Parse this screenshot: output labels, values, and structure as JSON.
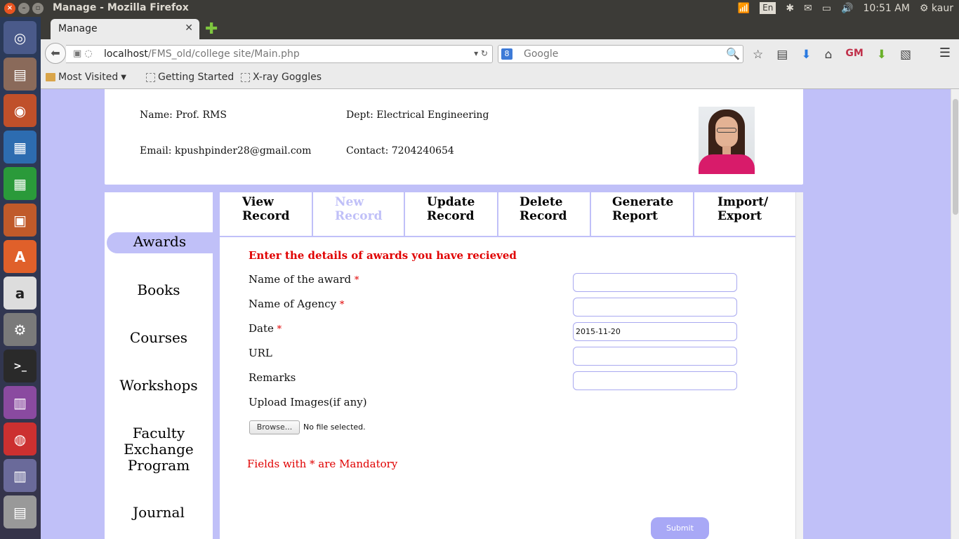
{
  "system": {
    "window_title": "Manage - Mozilla Firefox",
    "keyboard": "En",
    "time": "10:51 AM",
    "user": "kaur"
  },
  "browser": {
    "tab_title": "Manage",
    "url_host": "localhost",
    "url_path": "/FMS_old/college site/Main.php",
    "search_placeholder": "Google",
    "bookmarks": [
      "Most Visited",
      "Getting Started",
      "X-ray Goggles"
    ]
  },
  "profile": {
    "name": "Name: Prof. RMS",
    "dept": "Dept: Electrical Engineering",
    "email": "Email: kpushpinder28@gmail.com",
    "contact": "Contact: 7204240654"
  },
  "sidebar": {
    "items": [
      {
        "label": "Awards"
      },
      {
        "label": "Books"
      },
      {
        "label": "Courses"
      },
      {
        "label": "Workshops"
      },
      {
        "label": "Faculty Exchange Program"
      },
      {
        "label": "Journal"
      }
    ]
  },
  "tabs": [
    {
      "line1": "View",
      "line2": "Record"
    },
    {
      "line1": "New",
      "line2": "Record"
    },
    {
      "line1": "Update",
      "line2": "Record"
    },
    {
      "line1": "Delete",
      "line2": "Record"
    },
    {
      "line1": "Generate",
      "line2": "Report"
    },
    {
      "line1": "Import/",
      "line2": "Export"
    }
  ],
  "form": {
    "heading": "Enter the details of awards you have recieved",
    "fields": [
      {
        "label": "Name of the award",
        "required": "*",
        "value": ""
      },
      {
        "label": "Name of Agency",
        "required": "*",
        "value": ""
      },
      {
        "label": "Date",
        "required": "*",
        "value": "2015-11-20"
      },
      {
        "label": "URL",
        "value": ""
      },
      {
        "label": "Remarks",
        "value": ""
      }
    ],
    "upload_label": "Upload Images(if any)",
    "browse_label": "Browse...",
    "no_file": "No file selected.",
    "mandatory_note": "Fields with * are Mandatory",
    "submit_label": "Submit"
  }
}
